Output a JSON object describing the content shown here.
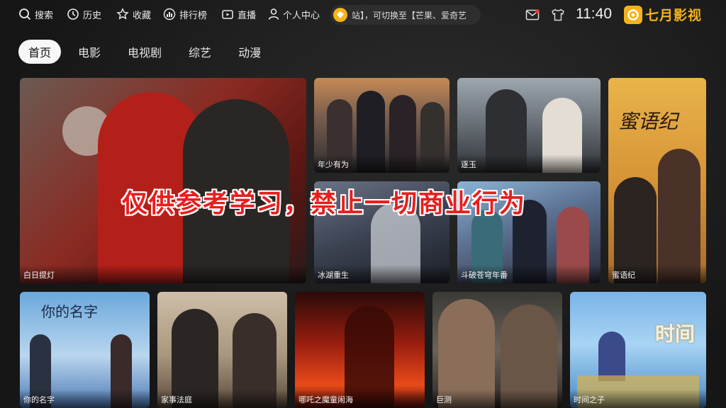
{
  "nav": {
    "search": "搜索",
    "history": "历史",
    "favorites": "收藏",
    "ranking": "排行榜",
    "live": "直播",
    "profile": "个人中心"
  },
  "marquee": {
    "text": "站】，可切换至【芒果、爱奇艺"
  },
  "status": {
    "time": "11:40"
  },
  "brand": {
    "name": "七月影视",
    "color": "#f5b21c"
  },
  "tabs": [
    {
      "label": "首页",
      "active": true
    },
    {
      "label": "电影",
      "active": false
    },
    {
      "label": "电视剧",
      "active": false
    },
    {
      "label": "综艺",
      "active": false
    },
    {
      "label": "动漫",
      "active": false
    }
  ],
  "featured": [
    {
      "title": "白日提灯"
    },
    {
      "title": "年少有为"
    },
    {
      "title": "逐玉"
    },
    {
      "title": "蜜语纪"
    },
    {
      "title": "冰湖重生"
    },
    {
      "title": "斗破苍穹年番"
    }
  ],
  "row2": [
    {
      "title": "你的名字",
      "poster_text": "你的名字"
    },
    {
      "title": "家事法庭"
    },
    {
      "title": "哪吒之魔童闹海"
    },
    {
      "title": "巨测"
    },
    {
      "title": "时间之子",
      "poster_text": "时间"
    }
  ],
  "poster_texts": {
    "mi_yu_ji": "蜜语纪"
  },
  "watermark": "仅供参考学习，禁止一切商业行为"
}
